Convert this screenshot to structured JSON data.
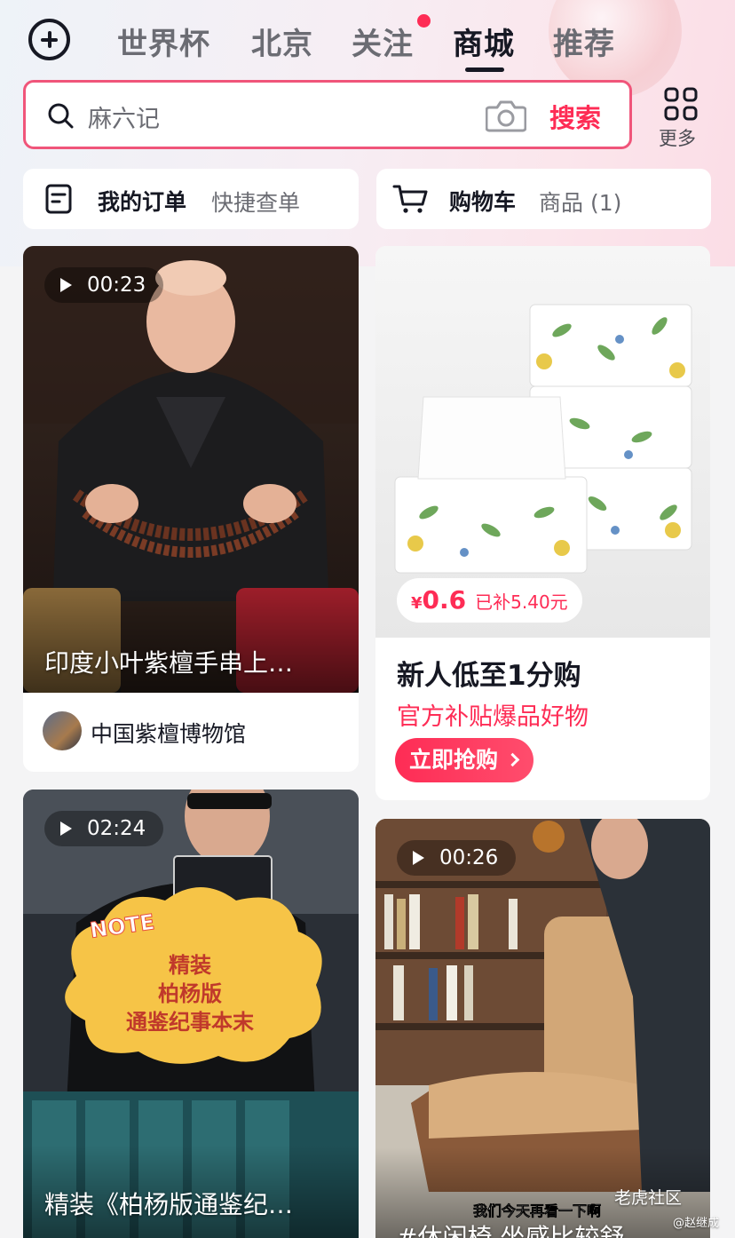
{
  "top_nav": {
    "tabs": [
      {
        "label": "世界杯"
      },
      {
        "label": "北京"
      },
      {
        "label": "关注"
      },
      {
        "label": "商城"
      },
      {
        "label": "推荐"
      }
    ],
    "active_tab": "商城"
  },
  "search": {
    "query": "麻六记",
    "button_label": "搜索",
    "more_label": "更多"
  },
  "quick_links": {
    "orders_title": "我的订单",
    "orders_sub": "快捷查单",
    "cart_title": "购物车",
    "cart_sub": "商品 (1)"
  },
  "feed": {
    "card1": {
      "duration": "00:23",
      "title": "印度小叶紫檀手串上…",
      "author": "中国紫檀博物馆"
    },
    "card2": {
      "price_symbol": "¥",
      "price": "0.6",
      "subsidy": "已补5.40元",
      "headline": "新人低至1分购",
      "subline": "官方补贴爆品好物",
      "cta": "立即抢购"
    },
    "card3": {
      "duration": "02:24",
      "note_tag": "NOTE",
      "note_lines": [
        "精装",
        "柏杨版",
        "通鉴纪事本末"
      ],
      "title": "精装《柏杨版通鉴纪…"
    },
    "card4": {
      "duration": "00:26",
      "burned_subtitle": "我们今天再看一下啊",
      "title": "#休闲椅 坐感比较舒…"
    }
  },
  "watermark": {
    "site": "老虎社区",
    "user": "@赵继成"
  },
  "colors": {
    "accent": "#fe2c55",
    "text_primary": "#161823",
    "text_secondary": "#6b6c73",
    "background": "#f4f4f5"
  },
  "icons": [
    "plus-circle-icon",
    "search-icon",
    "camera-icon",
    "grid-icon",
    "order-list-icon",
    "cart-icon",
    "play-icon",
    "chevron-right-icon"
  ]
}
